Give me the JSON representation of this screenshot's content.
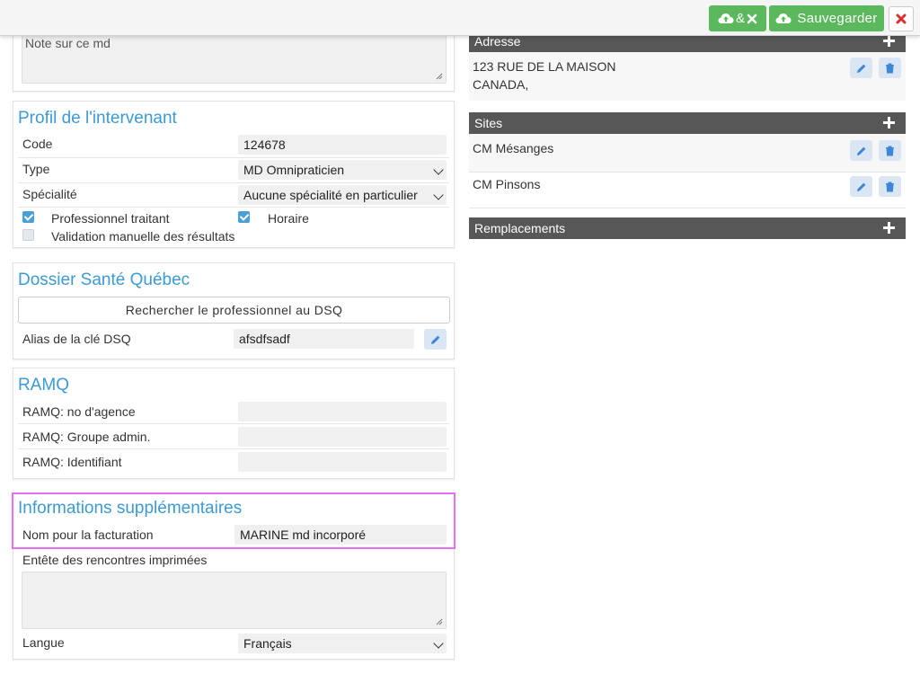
{
  "toolbar": {
    "save_close_amp": "&",
    "save_label": "Sauvegarder"
  },
  "note": {
    "placeholder": "Note sur ce md"
  },
  "profil": {
    "title": "Profil de l'intervenant",
    "code_label": "Code",
    "code_value": "124678",
    "type_label": "Type",
    "type_value": "MD Omnipraticien",
    "specialite_label": "Spécialité",
    "specialite_value": "Aucune spécialité en particulier",
    "prof_traitant_label": "Professionnel traitant",
    "horaire_label": "Horaire",
    "validation_label": "Validation manuelle des résultats",
    "prof_traitant_checked": true,
    "horaire_checked": true,
    "validation_checked": false
  },
  "dsq": {
    "title": "Dossier Santé Québec",
    "search_button": "Rechercher le professionnel au DSQ",
    "alias_label": "Alias de la clé DSQ",
    "alias_value": "afsdfsadf"
  },
  "ramq": {
    "title": "RAMQ",
    "agence_label": "RAMQ: no d'agence",
    "agence_value": "",
    "groupe_label": "RAMQ: Groupe admin.",
    "groupe_value": "",
    "identifiant_label": "RAMQ: Identifiant",
    "identifiant_value": ""
  },
  "infos": {
    "title": "Informations supplémentaires",
    "facturation_label": "Nom pour la facturation",
    "facturation_value": "MARINE md incorporé",
    "entete_label": "Entête des rencontres imprimées",
    "entete_value": "",
    "langue_label": "Langue",
    "langue_value": "Français"
  },
  "adresse": {
    "title": "Adresse",
    "line1": "123 RUE DE LA MAISON",
    "line2": "CANADA,"
  },
  "sites": {
    "title": "Sites",
    "items": [
      "CM Mésanges",
      "CM Pinsons"
    ]
  },
  "remplacements": {
    "title": "Remplacements"
  },
  "colors": {
    "accent": "#3c9ad6",
    "green": "#5cb85c",
    "danger": "#d9302c",
    "header_dark": "#575757",
    "highlight": "#e76ff0"
  }
}
